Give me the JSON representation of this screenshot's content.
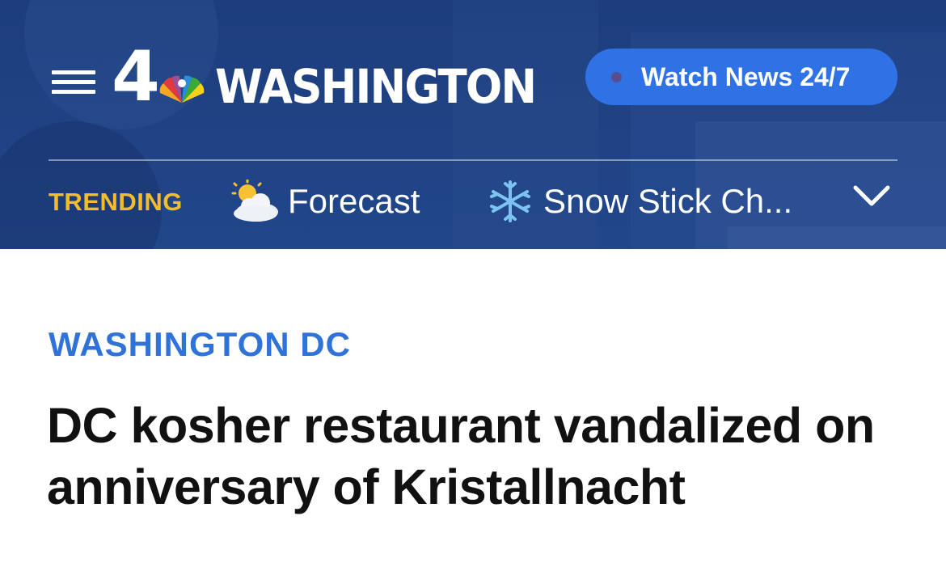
{
  "header": {
    "logo_number": "4",
    "logo_station": "WASHINGTON",
    "watch_button_label": "Watch News 24/7"
  },
  "trending": {
    "label": "TRENDING",
    "items": [
      {
        "icon": "partly-cloudy-icon",
        "label": "Forecast"
      },
      {
        "icon": "snowflake-icon",
        "label": "Snow Stick Ch..."
      }
    ]
  },
  "article": {
    "section": "WASHINGTON DC",
    "headline": "DC kosher restaurant vandalized on anniversary of Kristallnacht"
  },
  "colors": {
    "header_bg": "#1f4283",
    "watch_button": "#2f72e6",
    "trending_label": "#f1bd2b",
    "section_label": "#2f72d8",
    "headline": "#111111"
  }
}
